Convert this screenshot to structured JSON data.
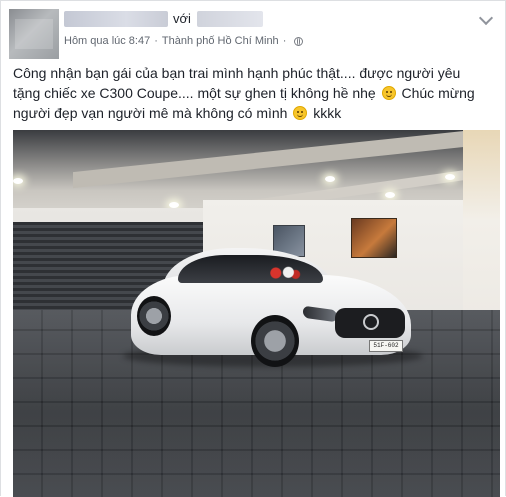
{
  "post": {
    "with_label": "với",
    "timestamp": "Hôm qua lúc 8:47",
    "separator": "·",
    "location": "Thành phố Hồ Chí Minh",
    "privacy_icon": "globe-icon",
    "menu_icon": "chevron-down-icon",
    "text_line1": "Công nhận bạn gái của bạn trai mình hạnh phúc thật.... được người yêu",
    "text_line2a": "tặng chiếc xe C300 Coupe.... một sự ghen tị không hề nhẹ",
    "text_line2b": "Chúc mừng",
    "text_line3a": "người đẹp vạn người mê mà không có mình",
    "text_line3b": "kkkk",
    "emoji": "smiley-emoji"
  },
  "photo": {
    "plate_text": "51F-602"
  },
  "colors": {
    "text": "#1d2129",
    "meta": "#616770",
    "border": "#dddfe2"
  }
}
